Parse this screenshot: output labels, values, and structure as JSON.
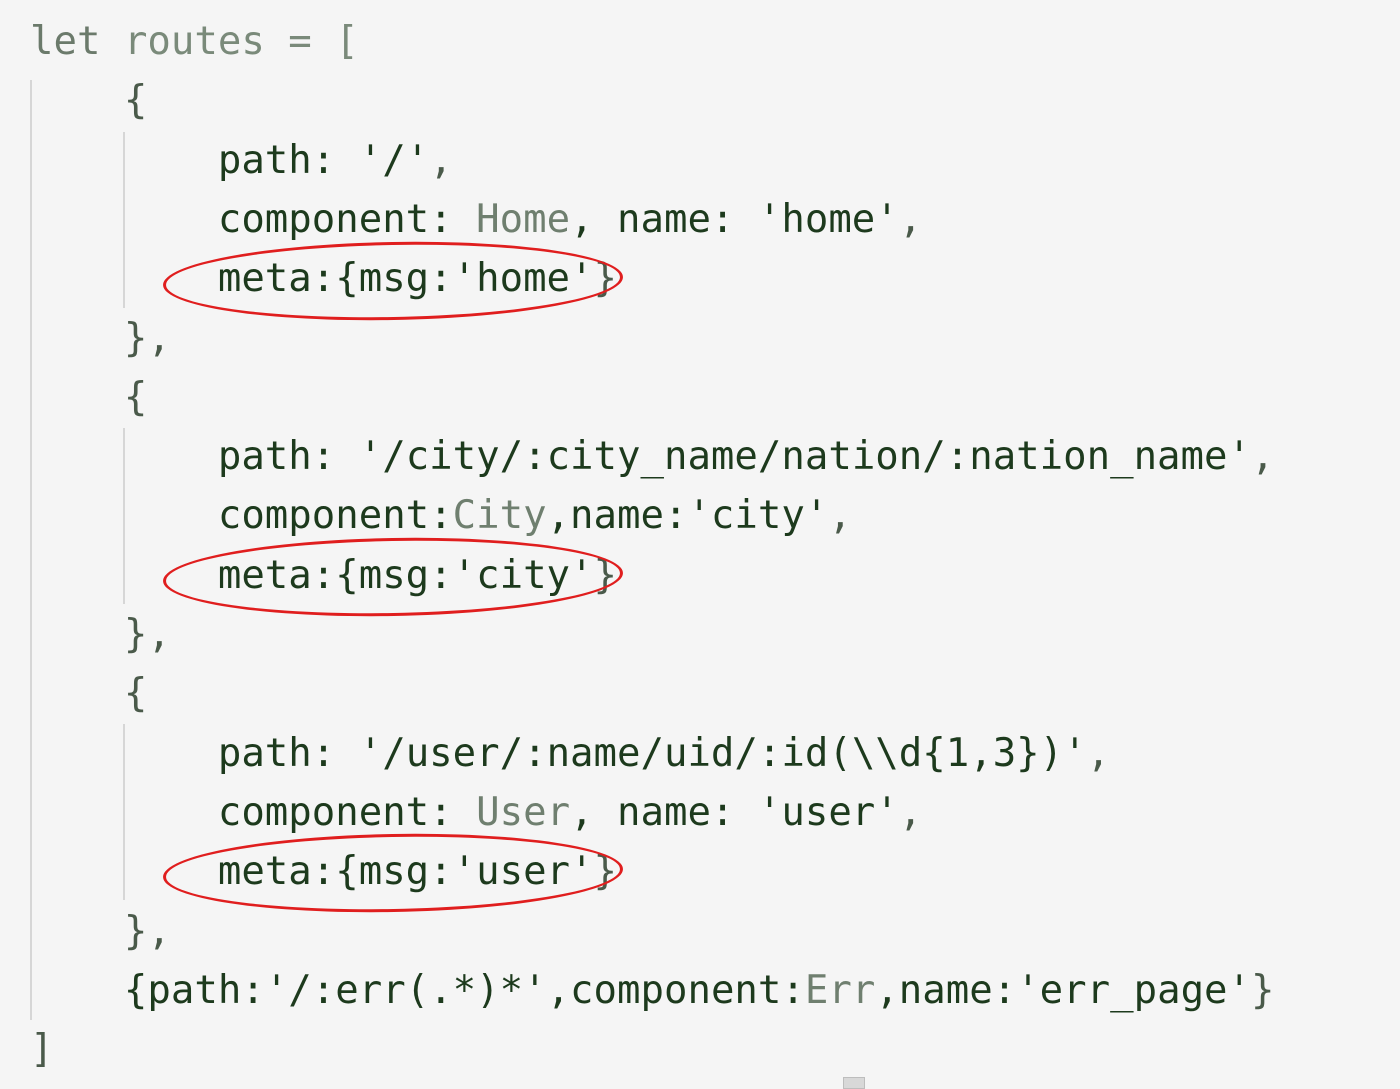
{
  "code_lines": [
    [
      {
        "t": "let",
        "c": "kw"
      },
      {
        "t": " ",
        "c": "punc"
      },
      {
        "t": "routes",
        "c": "var"
      },
      {
        "t": " = [",
        "c": "op"
      }
    ],
    [
      {
        "t": "    {",
        "c": "punc"
      }
    ],
    [
      {
        "t": "        path: ",
        "c": "prop"
      },
      {
        "t": "'/'",
        "c": "str"
      },
      {
        "t": ",",
        "c": "punc"
      }
    ],
    [
      {
        "t": "        component: ",
        "c": "prop"
      },
      {
        "t": "Home",
        "c": "ident"
      },
      {
        "t": ", name: ",
        "c": "prop"
      },
      {
        "t": "'home'",
        "c": "str"
      },
      {
        "t": ",",
        "c": "punc"
      }
    ],
    [
      {
        "t": "        meta:{msg:",
        "c": "prop"
      },
      {
        "t": "'home'",
        "c": "str"
      },
      {
        "t": "}",
        "c": "punc"
      }
    ],
    [
      {
        "t": "    },",
        "c": "punc"
      }
    ],
    [
      {
        "t": "    {",
        "c": "punc"
      }
    ],
    [
      {
        "t": "        path: ",
        "c": "prop"
      },
      {
        "t": "'/city/:city_name/nation/:nation_name'",
        "c": "str"
      },
      {
        "t": ",",
        "c": "punc"
      }
    ],
    [
      {
        "t": "        component:",
        "c": "prop"
      },
      {
        "t": "City",
        "c": "ident"
      },
      {
        "t": ",name:",
        "c": "prop"
      },
      {
        "t": "'city'",
        "c": "str"
      },
      {
        "t": ",",
        "c": "punc"
      }
    ],
    [
      {
        "t": "        meta:{msg:",
        "c": "prop"
      },
      {
        "t": "'city'",
        "c": "str"
      },
      {
        "t": "}",
        "c": "punc"
      }
    ],
    [
      {
        "t": "    },",
        "c": "punc"
      }
    ],
    [
      {
        "t": "    {",
        "c": "punc"
      }
    ],
    [
      {
        "t": "        path: ",
        "c": "prop"
      },
      {
        "t": "'/user/:name/uid/:id(\\\\d{1,3})'",
        "c": "str"
      },
      {
        "t": ",",
        "c": "punc"
      }
    ],
    [
      {
        "t": "        component: ",
        "c": "prop"
      },
      {
        "t": "User",
        "c": "ident"
      },
      {
        "t": ", name: ",
        "c": "prop"
      },
      {
        "t": "'user'",
        "c": "str"
      },
      {
        "t": ",",
        "c": "punc"
      }
    ],
    [
      {
        "t": "        meta:{msg:",
        "c": "prop"
      },
      {
        "t": "'user'",
        "c": "str"
      },
      {
        "t": "}",
        "c": "punc"
      }
    ],
    [
      {
        "t": "    },",
        "c": "punc"
      }
    ],
    [
      {
        "t": "    {path:",
        "c": "prop"
      },
      {
        "t": "'/:err(.*)*'",
        "c": "str"
      },
      {
        "t": ",component:",
        "c": "prop"
      },
      {
        "t": "Err",
        "c": "ident"
      },
      {
        "t": ",name:",
        "c": "prop"
      },
      {
        "t": "'err_page'",
        "c": "str"
      },
      {
        "t": "}",
        "c": "punc"
      }
    ],
    [
      {
        "t": "]",
        "c": "punc"
      }
    ]
  ],
  "annotation_color": "#e01e1e"
}
